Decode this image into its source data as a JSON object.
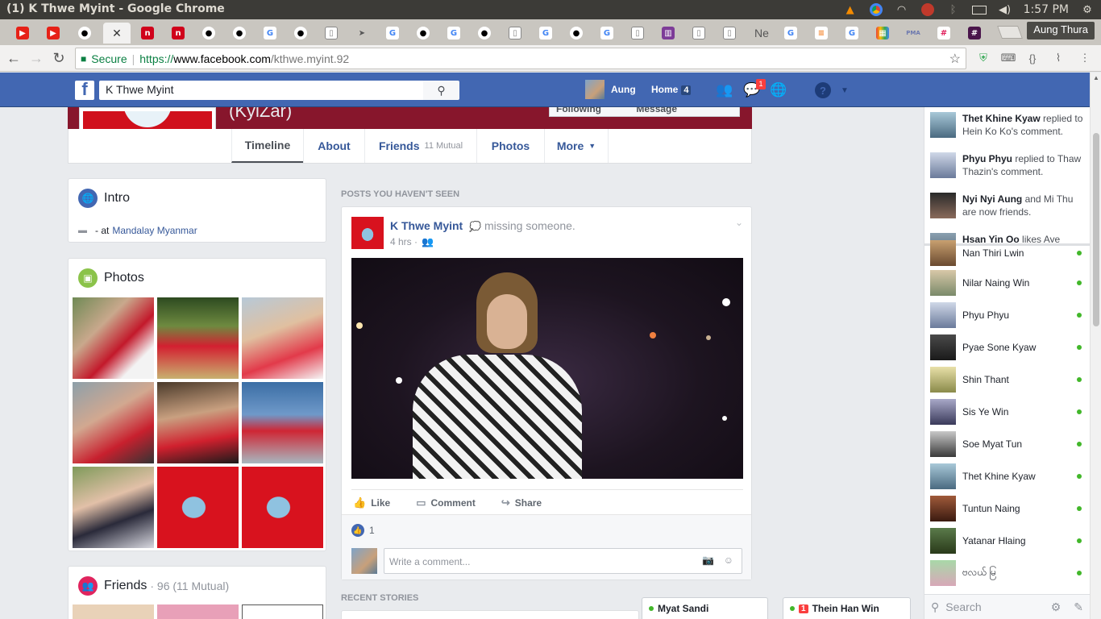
{
  "os": {
    "window_title": "(1) K Thwe Myint - Google Chrome",
    "clock": "1:57 PM"
  },
  "browser": {
    "profile_name": "Aung Thura",
    "tab_ne_label": "Ne",
    "secure_label": "Secure",
    "url_scheme": "https://",
    "url_host": "www.facebook.com",
    "url_path": "/kthwe.myint.92"
  },
  "fb": {
    "search_value": "K Thwe Myint",
    "nav_user": "Aung",
    "nav_home": "Home",
    "home_count": "4",
    "messages_badge": "1"
  },
  "profile": {
    "nickname": "(KyiZar)",
    "following_label": "Following",
    "message_label": "Message",
    "tabs": [
      {
        "label": "Timeline"
      },
      {
        "label": "About"
      },
      {
        "label": "Friends",
        "extra": "11 Mutual"
      },
      {
        "label": "Photos"
      },
      {
        "label": "More"
      }
    ]
  },
  "intro": {
    "title": "Intro",
    "line_prefix": "- at",
    "location": "Mandalay Myanmar"
  },
  "photos": {
    "title": "Photos"
  },
  "friends": {
    "title": "Friends",
    "count": "· 96 (11 Mutual)"
  },
  "feed": {
    "section_unseen": "POSTS YOU HAVEN'T SEEN",
    "section_recent": "RECENT STORIES",
    "post": {
      "author": "K Thwe Myint",
      "feeling": "missing someone.",
      "time": "4 hrs ·",
      "like_label": "Like",
      "comment_label": "Comment",
      "share_label": "Share",
      "like_count": "1",
      "comment_placeholder": "Write a comment..."
    }
  },
  "ticker": [
    {
      "name": "Thet Khine Kyaw",
      "text": "replied to Hein Ko Ko's comment."
    },
    {
      "name": "Phyu Phyu",
      "text": "replied to Thaw Thazin's comment."
    },
    {
      "name": "Nyi Nyi Aung",
      "text": "and Mi Thu are now friends."
    },
    {
      "name": "Hsan Yin Oo",
      "text": "likes Aye"
    }
  ],
  "chat_contacts": [
    "Nan Thiri Lwin",
    "Nilar Naing Win",
    "Phyu Phyu",
    "Pyae Sone Kyaw",
    "Shin Thant",
    "Sis Ye Win",
    "Soe Myat Tun",
    "Thet Khine Kyaw",
    "Tuntun Naing",
    "Yatanar Hlaing",
    "ဗလယ် မြ"
  ],
  "chat_search_placeholder": "Search",
  "chat_tabs": [
    {
      "name": "Myat Sandi"
    },
    {
      "name": "Thein Han Win",
      "badge": "1"
    }
  ],
  "colors": {
    "fb_blue": "#4267b2",
    "link": "#365899",
    "online": "#42b72a",
    "badge": "#fa3e3e"
  }
}
